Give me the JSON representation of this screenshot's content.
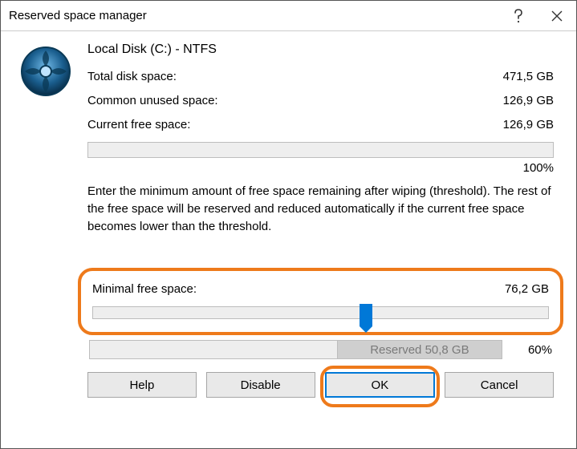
{
  "window": {
    "title": "Reserved space manager"
  },
  "disk": {
    "name": "Local Disk (C:) - NTFS",
    "total_label": "Total disk space:",
    "total_value": "471,5 GB",
    "unused_label": "Common unused space:",
    "unused_value": "126,9 GB",
    "free_label": "Current free space:",
    "free_value": "126,9 GB",
    "free_pct": "100%"
  },
  "instruction": "Enter the minimum amount of free space remaining after wiping (threshold). The rest of the free space will be reserved and reduced automatically if the current free space becomes lower than the threshold.",
  "slider": {
    "label": "Minimal free space:",
    "value_text": "76,2 GB",
    "position_pct": 60
  },
  "reserved": {
    "label": "Reserved 50,8 GB",
    "fill_pct": 40,
    "pct_text": "60%"
  },
  "buttons": {
    "help": "Help",
    "disable": "Disable",
    "ok": "OK",
    "cancel": "Cancel"
  }
}
